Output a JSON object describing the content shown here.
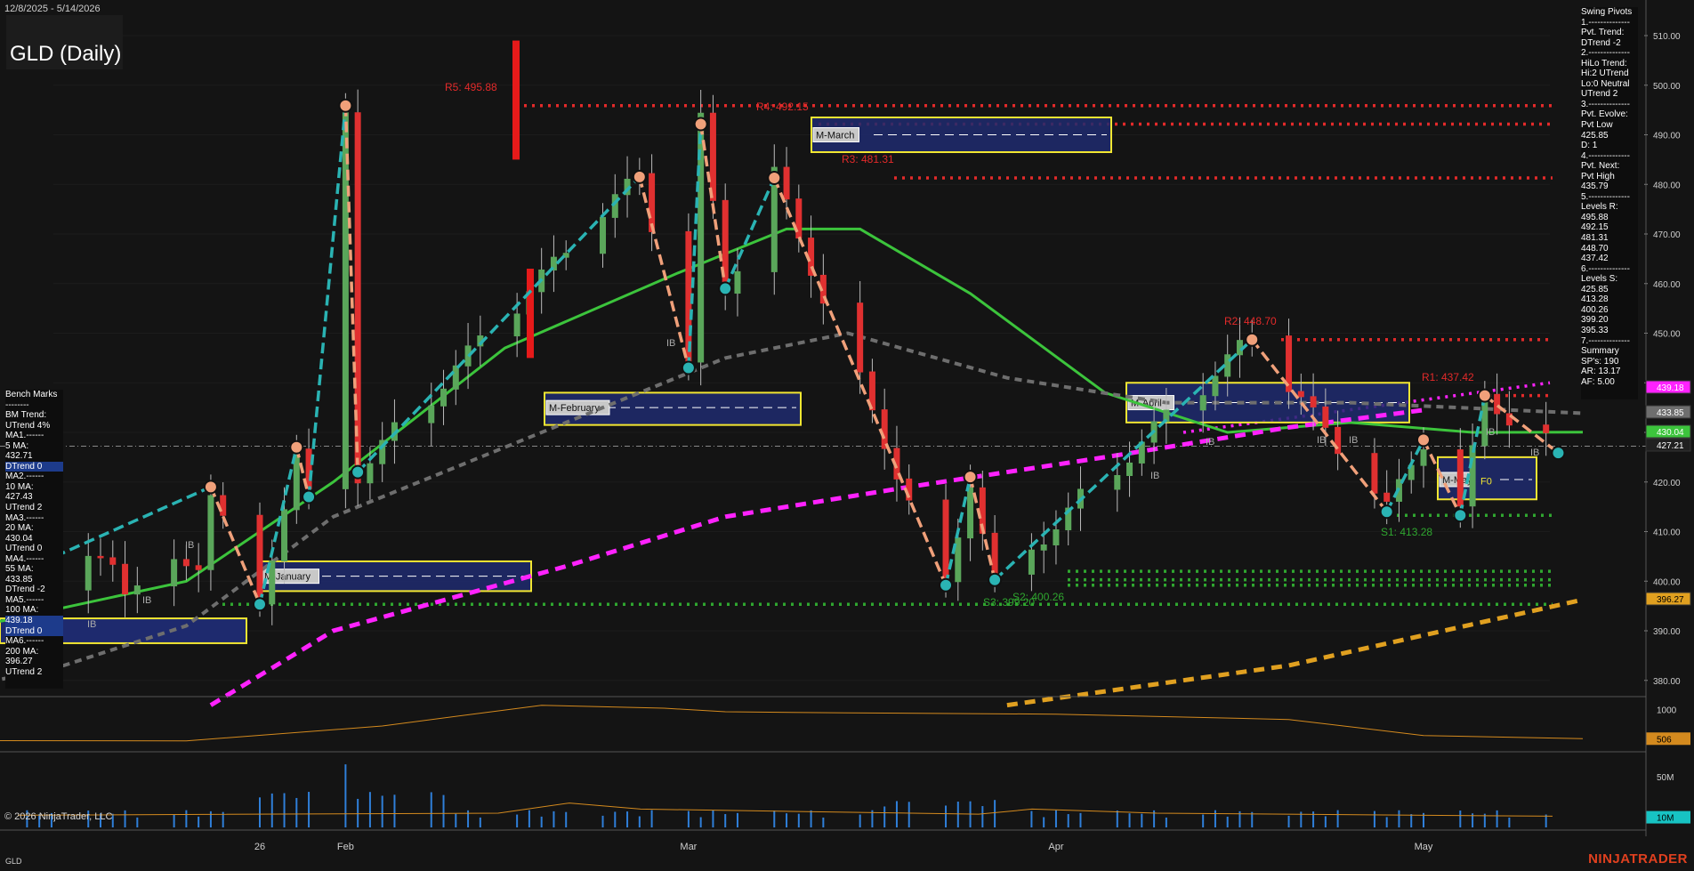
{
  "header": {
    "date_range": "12/8/2025 - 5/14/2026",
    "instrument_title": "GLD (Daily)"
  },
  "footer": {
    "copyright": "© 2026 NinjaTrader, LLC",
    "symbol": "GLD",
    "brand": "NINJATRADER"
  },
  "colors": {
    "background": "#141414",
    "up_candle": "#5aa65a",
    "down_candle": "#e03030",
    "ma_fast": "#3cc43c",
    "ma_grey": "#6e6e6e",
    "ma_magenta": "#ff22ff",
    "ma_gold": "#e0a020",
    "swing_up": "#2ab3b3",
    "swing_down": "#f0a07a",
    "resistance": "#e32a2a",
    "support": "#2fa62f",
    "box_fill": "#1e2a6e",
    "box_border": "#f2e632",
    "volume": "#2f7fd9",
    "osc": "#d48a1e"
  },
  "bench_panel": {
    "lines": [
      "Bench Marks",
      "--------",
      "BM Trend:",
      "UTrend 4%",
      "MA1.------",
      "5 MA:",
      "432.71",
      "DTrend 0",
      "MA2.------",
      "10 MA:",
      "427.43",
      "UTrend 2",
      "MA3.------",
      "20 MA:",
      "430.04",
      "UTrend 0",
      "MA4.------",
      "55 MA:",
      "433.85",
      "DTrend -2",
      "MA5.------",
      "100 MA:",
      "439.18",
      "DTrend 0",
      "MA6.------",
      "200 MA:",
      "396.27",
      "UTrend 2"
    ],
    "highlight_lines": [
      "439.18",
      "DTrend 0"
    ]
  },
  "pivot_panel": {
    "lines": [
      "Swing Pivots",
      "1.--------------",
      "Pvt. Trend:",
      "DTrend -2",
      "2.--------------",
      "HiLo Trend:",
      "Hi:2 UTrend",
      "Lo:0 Neutral",
      "UTrend 2",
      "3.--------------",
      "Pvt. Evolve:",
      "Pvt Low",
      "425.85",
      "D: 1",
      "4.--------------",
      "Pvt. Next:",
      "Pvt High",
      "435.79",
      "5.--------------",
      "Levels R:",
      "495.88",
      "492.15",
      "481.31",
      "448.70",
      "437.42",
      "6.--------------",
      "Levels S:",
      "425.85",
      "413.28",
      "400.26",
      "399.20",
      "395.33",
      "7.--------------",
      "Summary",
      "SP's: 190",
      "AR: 13.17",
      "AF: 5.00"
    ]
  },
  "chart_data": {
    "type": "candlestick",
    "title": "GLD (Daily)",
    "y_axis": {
      "range": [
        375,
        515
      ],
      "ticks": [
        510,
        500,
        490,
        480,
        470,
        460,
        450,
        440,
        430,
        420,
        410,
        400,
        390,
        380
      ],
      "tick_labels": [
        "510.00",
        "500.00",
        "490.00",
        "480.00",
        "470.00",
        "460.00",
        "450.00",
        "440.00",
        "430.00",
        "420.00",
        "410.00",
        "400.00",
        "390.00",
        "380.00"
      ]
    },
    "x_axis": {
      "labels": [
        "26",
        "Feb",
        "Mar",
        "Apr",
        "May"
      ],
      "label_dates": [
        "2026-01-26",
        "2026-02-02",
        "2026-03-02",
        "2026-04-01",
        "2026-05-01"
      ]
    },
    "price_badges": [
      {
        "value": "439.18",
        "color": "#ff22ff",
        "text_color": "#ffffff"
      },
      {
        "value": "433.85",
        "color": "#6e6e6e",
        "text_color": "#ffffff"
      },
      {
        "value": "430.04",
        "color": "#3cc43c",
        "text_color": "#ffffff"
      },
      {
        "value": "427.21",
        "color": "#202020",
        "text_color": "#ffffff"
      },
      {
        "value": "396.27",
        "color": "#e0a020",
        "text_color": "#000000"
      }
    ],
    "resistance_labels": [
      {
        "text": "R5: 495.88",
        "value": 495.88
      },
      {
        "text": "R4: 492.15",
        "value": 492.15
      },
      {
        "text": "R3: 481.31",
        "value": 481.31
      },
      {
        "text": "R2: 448.70",
        "value": 448.7
      },
      {
        "text": "R1: 437.42",
        "value": 437.42
      }
    ],
    "support_labels": [
      {
        "text": "S1: 413.28",
        "value": 413.28
      },
      {
        "text": "S2: 400.26",
        "value": 400.26
      },
      {
        "text": "S3: 399.20",
        "value": 399.2
      }
    ],
    "month_boxes": [
      {
        "label": "M-January",
        "high": 404,
        "low": 398,
        "mid": 401
      },
      {
        "label": "M-February",
        "high": 438,
        "low": 431.5,
        "mid": 435
      },
      {
        "label": "M-March",
        "high": 493.5,
        "low": 486.5,
        "mid": 490
      },
      {
        "label": "M-April",
        "high": 440,
        "low": 432,
        "mid": 436
      },
      {
        "label": "M-May",
        "high": 425,
        "low": 416.5,
        "mid": 420.5
      }
    ],
    "f0_label": "F0",
    "ib_label": "IB",
    "swing_pivots": [
      {
        "date": "2026-01-22",
        "price": 419,
        "type": "high"
      },
      {
        "date": "2026-01-26",
        "price": 395.33,
        "type": "low"
      },
      {
        "date": "2026-01-29",
        "price": 427,
        "type": "high"
      },
      {
        "date": "2026-01-30",
        "price": 417,
        "type": "low"
      },
      {
        "date": "2026-02-02",
        "price": 495.88,
        "type": "high"
      },
      {
        "date": "2026-02-03",
        "price": 422,
        "type": "low"
      },
      {
        "date": "2026-02-26",
        "price": 481.5,
        "type": "high"
      },
      {
        "date": "2026-03-02",
        "price": 443,
        "type": "low"
      },
      {
        "date": "2026-03-03",
        "price": 492.15,
        "type": "high"
      },
      {
        "date": "2026-03-05",
        "price": 459,
        "type": "low"
      },
      {
        "date": "2026-03-09",
        "price": 481.31,
        "type": "high"
      },
      {
        "date": "2026-03-23",
        "price": 399.2,
        "type": "low"
      },
      {
        "date": "2026-03-25",
        "price": 421,
        "type": "high"
      },
      {
        "date": "2026-03-27",
        "price": 400.26,
        "type": "low"
      },
      {
        "date": "2026-04-17",
        "price": 448.7,
        "type": "high"
      },
      {
        "date": "2026-04-28",
        "price": 414,
        "type": "low"
      },
      {
        "date": "2026-05-01",
        "price": 428.5,
        "type": "high"
      },
      {
        "date": "2026-05-04",
        "price": 413.28,
        "type": "low"
      },
      {
        "date": "2026-05-06",
        "price": 437.42,
        "type": "high"
      },
      {
        "date": "2026-05-12",
        "price": 425.85,
        "type": "low"
      }
    ],
    "series": [
      {
        "name": "5 MA",
        "last": 432.71
      },
      {
        "name": "10 MA",
        "last": 427.43
      },
      {
        "name": "20 MA",
        "last": 430.04
      },
      {
        "name": "55 MA",
        "last": 433.85
      },
      {
        "name": "100 MA",
        "last": 439.18
      },
      {
        "name": "200 MA",
        "last": 396.27
      }
    ],
    "last_price": 427.21,
    "oscillator": {
      "ticks": [
        "1000"
      ],
      "last_label": "506",
      "last": 506,
      "range": [
        300,
        1200
      ]
    },
    "volume": {
      "ticks": [
        "50M"
      ],
      "last_label": "10M",
      "last": 10,
      "range": [
        0,
        70
      ]
    }
  }
}
